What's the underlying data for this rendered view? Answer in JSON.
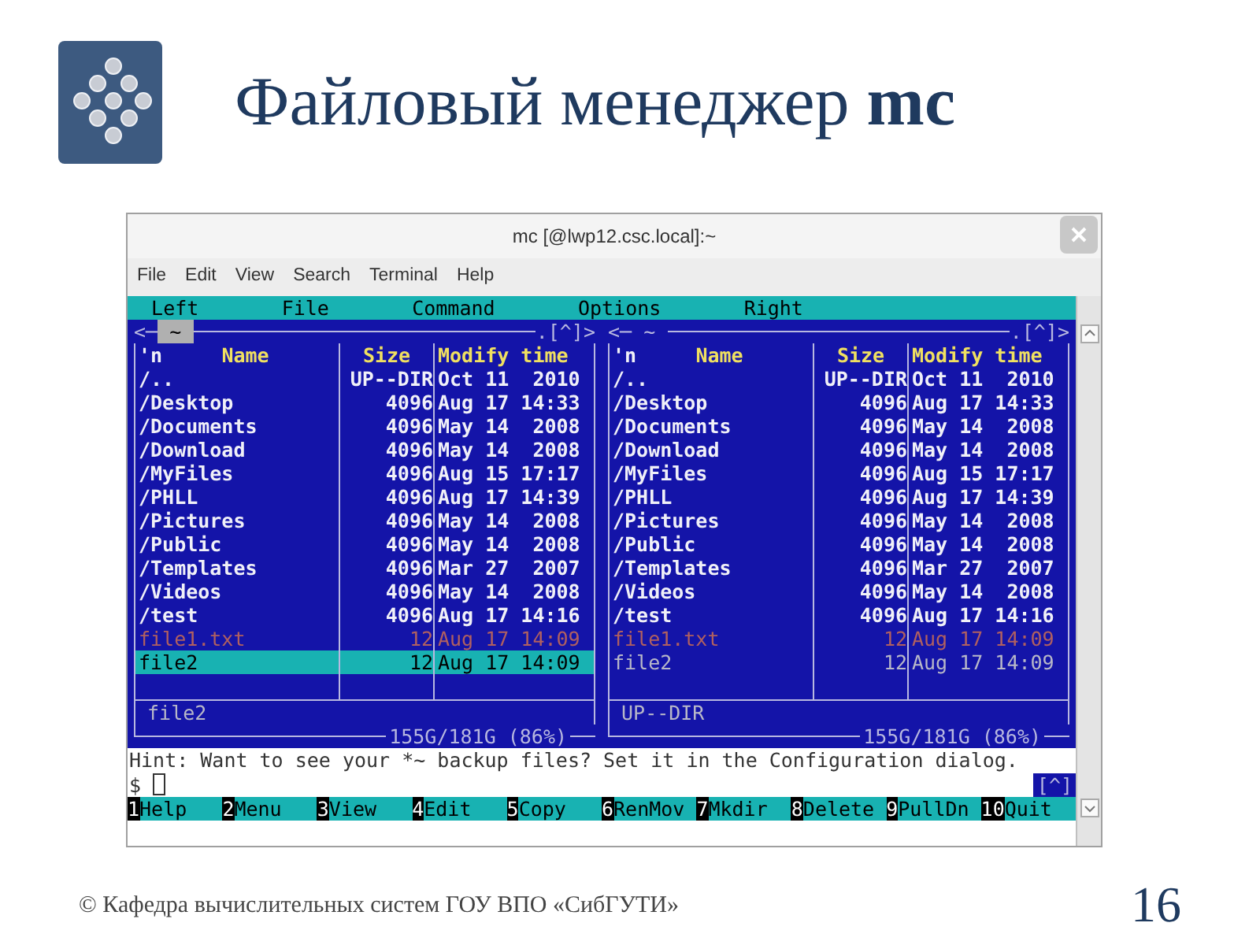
{
  "slide": {
    "title": "Файловый менеджер **mc**",
    "footer": "© Кафедра вычислительных систем ГОУ ВПО «СибГУТИ»",
    "page_number": "16"
  },
  "window": {
    "title": "mc [@lwp12.csc.local]:~"
  },
  "menu": [
    "File",
    "Edit",
    "View",
    "Search",
    "Terminal",
    "Help"
  ],
  "mc_menu": [
    "Left",
    "File",
    "Command",
    "Options",
    "Right"
  ],
  "panels": [
    {
      "left_marker": "<─",
      "path": "~",
      "path_active": true,
      "right_marker": ".[^]>",
      "sort_mark": "'n",
      "columns": [
        "Name",
        "Size",
        "Modify time"
      ],
      "rows": [
        {
          "name": "/..",
          "size": "UP--DIR",
          "modified": "Oct 11  2010",
          "kind": "dir",
          "selected": false
        },
        {
          "name": "/Desktop",
          "size": "4096",
          "modified": "Aug 17 14:33",
          "kind": "dir",
          "selected": false
        },
        {
          "name": "/Documents",
          "size": "4096",
          "modified": "May 14  2008",
          "kind": "dir",
          "selected": false
        },
        {
          "name": "/Download",
          "size": "4096",
          "modified": "May 14  2008",
          "kind": "dir",
          "selected": false
        },
        {
          "name": "/MyFiles",
          "size": "4096",
          "modified": "Aug 15 17:17",
          "kind": "dir",
          "selected": false
        },
        {
          "name": "/PHLL",
          "size": "4096",
          "modified": "Aug 17 14:39",
          "kind": "dir",
          "selected": false
        },
        {
          "name": "/Pictures",
          "size": "4096",
          "modified": "May 14  2008",
          "kind": "dir",
          "selected": false
        },
        {
          "name": "/Public",
          "size": "4096",
          "modified": "May 14  2008",
          "kind": "dir",
          "selected": false
        },
        {
          "name": "/Templates",
          "size": "4096",
          "modified": "Mar 27  2007",
          "kind": "dir",
          "selected": false
        },
        {
          "name": "/Videos",
          "size": "4096",
          "modified": "May 14  2008",
          "kind": "dir",
          "selected": false
        },
        {
          "name": "/test",
          "size": "4096",
          "modified": "Aug 17 14:16",
          "kind": "dir",
          "selected": false
        },
        {
          "name": "file1.txt",
          "size": "12",
          "modified": "Aug 17 14:09",
          "kind": "backup",
          "selected": false
        },
        {
          "name": "file2",
          "size": "12",
          "modified": "Aug 17 14:09",
          "kind": "file",
          "selected": true
        }
      ],
      "mini_status": "file2",
      "disk": "155G/181G (86%)"
    },
    {
      "left_marker": "<─",
      "path": "~",
      "path_active": false,
      "right_marker": ".[^]>",
      "sort_mark": "'n",
      "columns": [
        "Name",
        "Size",
        "Modify time"
      ],
      "rows": [
        {
          "name": "/..",
          "size": "UP--DIR",
          "modified": "Oct 11  2010",
          "kind": "dir",
          "selected": false
        },
        {
          "name": "/Desktop",
          "size": "4096",
          "modified": "Aug 17 14:33",
          "kind": "dir",
          "selected": false
        },
        {
          "name": "/Documents",
          "size": "4096",
          "modified": "May 14  2008",
          "kind": "dir",
          "selected": false
        },
        {
          "name": "/Download",
          "size": "4096",
          "modified": "May 14  2008",
          "kind": "dir",
          "selected": false
        },
        {
          "name": "/MyFiles",
          "size": "4096",
          "modified": "Aug 15 17:17",
          "kind": "dir",
          "selected": false
        },
        {
          "name": "/PHLL",
          "size": "4096",
          "modified": "Aug 17 14:39",
          "kind": "dir",
          "selected": false
        },
        {
          "name": "/Pictures",
          "size": "4096",
          "modified": "May 14  2008",
          "kind": "dir",
          "selected": false
        },
        {
          "name": "/Public",
          "size": "4096",
          "modified": "May 14  2008",
          "kind": "dir",
          "selected": false
        },
        {
          "name": "/Templates",
          "size": "4096",
          "modified": "Mar 27  2007",
          "kind": "dir",
          "selected": false
        },
        {
          "name": "/Videos",
          "size": "4096",
          "modified": "May 14  2008",
          "kind": "dir",
          "selected": false
        },
        {
          "name": "/test",
          "size": "4096",
          "modified": "Aug 17 14:16",
          "kind": "dir",
          "selected": false
        },
        {
          "name": "file1.txt",
          "size": "12",
          "modified": "Aug 17 14:09",
          "kind": "backup",
          "selected": false
        },
        {
          "name": "file2",
          "size": "12",
          "modified": "Aug 17 14:09",
          "kind": "file",
          "selected": false
        }
      ],
      "mini_status": "UP--DIR",
      "disk": "155G/181G (86%)"
    }
  ],
  "hint": "Hint: Want to see your *~ backup files? Set it in the Configuration dialog.",
  "prompt": "$",
  "scroll_marker": "[^]",
  "fkeys": [
    {
      "num": "1",
      "label": "Help"
    },
    {
      "num": "2",
      "label": "Menu"
    },
    {
      "num": "3",
      "label": "View"
    },
    {
      "num": "4",
      "label": "Edit"
    },
    {
      "num": "5",
      "label": "Copy"
    },
    {
      "num": "6",
      "label": "RenMov"
    },
    {
      "num": "7",
      "label": "Mkdir"
    },
    {
      "num": "8",
      "label": "Delete"
    },
    {
      "num": "9",
      "label": "PullDn"
    },
    {
      "num": "10",
      "label": "Quit"
    }
  ]
}
